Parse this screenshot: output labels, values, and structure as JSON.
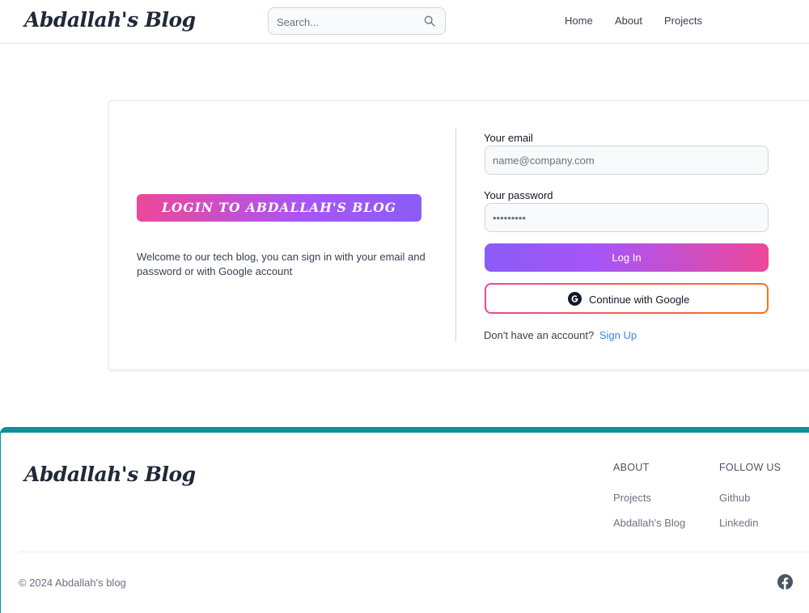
{
  "header": {
    "logo": "Abdallah's Blog",
    "search_placeholder": "Search...",
    "nav": [
      "Home",
      "About",
      "Projects"
    ]
  },
  "login": {
    "banner": "LOGIN TO ABDALLAH'S BLOG",
    "welcome": "Welcome to our tech blog, you can sign in with your email and password or with Google account",
    "email_label": "Your email",
    "email_placeholder": "name@company.com",
    "password_label": "Your password",
    "password_placeholder": "•••••••••",
    "login_button": "Log In",
    "google_button": "Continue with Google",
    "no_account": "Don't have an account?",
    "signup_link": "Sign Up"
  },
  "footer": {
    "logo": "Abdallah's Blog",
    "about_heading": "ABOUT",
    "about_links": [
      "Projects",
      "Abdallah's Blog"
    ],
    "follow_heading": "FOLLOW US",
    "follow_links": [
      "Github",
      "Linkedin"
    ],
    "copyright": "© 2024 Abdallah's blog"
  },
  "colors": {
    "accent_teal": "#0e8f9b",
    "gradient_pink": "#ec4899",
    "gradient_purple": "#8b5cf6",
    "link_blue": "#3b82f6"
  },
  "icons": {
    "search": "search-icon",
    "google": "google-icon",
    "facebook": "facebook-icon"
  }
}
